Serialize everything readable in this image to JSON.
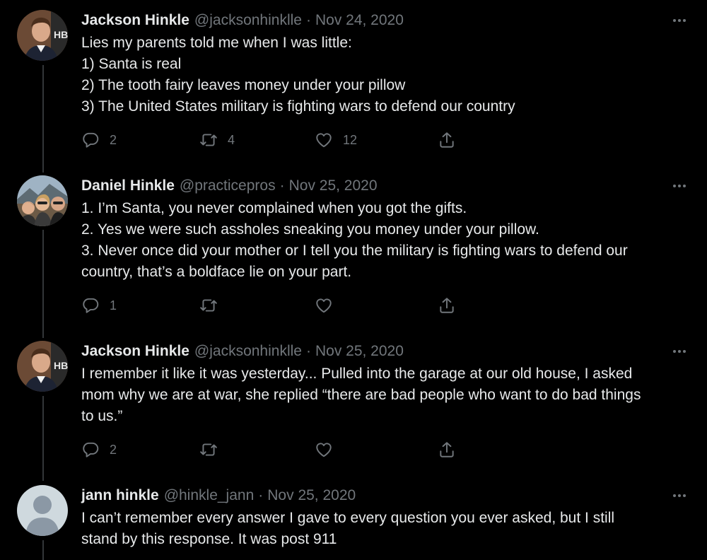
{
  "tweets": [
    {
      "name": "Jackson Hinkle",
      "handle": "@jacksonhinklle",
      "separator": "·",
      "date": "Nov 24, 2020",
      "lines": [
        "Lies my parents told me when I was little:",
        "1) Santa is real",
        "2) The tooth fairy leaves money under your pillow",
        "3) The United States military is fighting wars to defend our country"
      ],
      "reply_count": "2",
      "retweet_count": "4",
      "like_count": "12"
    },
    {
      "name": "Daniel Hinkle",
      "handle": "@practicepros",
      "separator": "·",
      "date": "Nov 25, 2020",
      "lines": [
        "1. I’m Santa, you never complained when you got the gifts.",
        "2. Yes we were such assholes sneaking you money under your pillow.",
        "3. Never once did your mother or I tell you the military is fighting wars to defend our",
        "country, that’s a boldface lie on your part."
      ],
      "reply_count": "1",
      "retweet_count": "",
      "like_count": ""
    },
    {
      "name": "Jackson Hinkle",
      "handle": "@jacksonhinklle",
      "separator": "·",
      "date": "Nov 25, 2020",
      "lines": [
        "I remember it like it was yesterday... Pulled into the garage at our old house, I asked",
        "mom why we are at war, she replied “there are bad people who want to do bad things",
        "to us.”"
      ],
      "reply_count": "2",
      "retweet_count": "",
      "like_count": ""
    },
    {
      "name": "jann hinkle",
      "handle": "@hinkle_jann",
      "separator": "·",
      "date": "Nov 25, 2020",
      "lines": [
        "I can’t remember every answer I gave to every question you ever asked, but I still",
        "stand by this response. It was post 911"
      ]
    }
  ],
  "icons": {
    "reply": "reply-icon",
    "retweet": "retweet-icon",
    "like": "like-icon",
    "share": "share-icon",
    "more": "more-icon"
  },
  "colors": {
    "background": "#000000",
    "text": "#e7e9ea",
    "secondary": "#71767b",
    "thread_line": "#333639"
  }
}
